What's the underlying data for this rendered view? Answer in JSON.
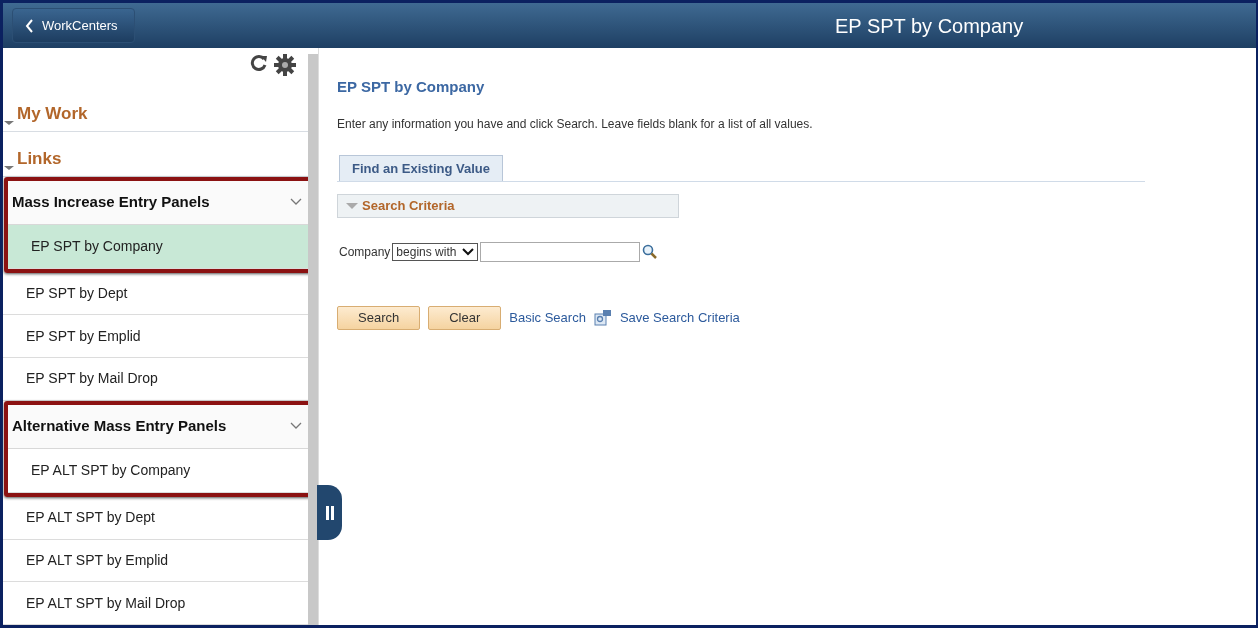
{
  "header": {
    "back_button": "WorkCenters",
    "title": "EP SPT by Company"
  },
  "sidebar": {
    "sections": [
      {
        "label": "My Work",
        "expanded": true
      },
      {
        "label": "Links",
        "expanded": true
      }
    ],
    "groups": [
      {
        "title": "Mass Increase Entry Panels",
        "highlighted": true,
        "items": [
          {
            "label": "EP SPT by Company",
            "selected": true,
            "highlighted": true
          },
          {
            "label": "EP SPT by Dept",
            "selected": false,
            "highlighted": false
          },
          {
            "label": "EP SPT by Emplid",
            "selected": false,
            "highlighted": false
          },
          {
            "label": "EP SPT by Mail Drop",
            "selected": false,
            "highlighted": false
          }
        ]
      },
      {
        "title": "Alternative Mass Entry Panels",
        "highlighted": true,
        "items": [
          {
            "label": "EP ALT SPT by Company",
            "selected": false,
            "highlighted": true
          },
          {
            "label": "EP ALT SPT by Dept",
            "selected": false,
            "highlighted": false
          },
          {
            "label": "EP ALT SPT by Emplid",
            "selected": false,
            "highlighted": false
          },
          {
            "label": "EP ALT SPT by Mail Drop",
            "selected": false,
            "highlighted": false
          }
        ]
      }
    ]
  },
  "main": {
    "title": "EP SPT by Company",
    "instructions": "Enter any information you have and click Search. Leave fields blank for a list of all values.",
    "tabs": [
      {
        "label": "Find an Existing Value",
        "selected": true
      }
    ],
    "section": {
      "label": "Search Criteria",
      "expanded": true
    },
    "field": {
      "label": "Company",
      "operator": "begins with"
    },
    "buttons": [
      "Search",
      "Clear"
    ],
    "links": [
      "Basic Search",
      "Save Search Criteria"
    ]
  }
}
